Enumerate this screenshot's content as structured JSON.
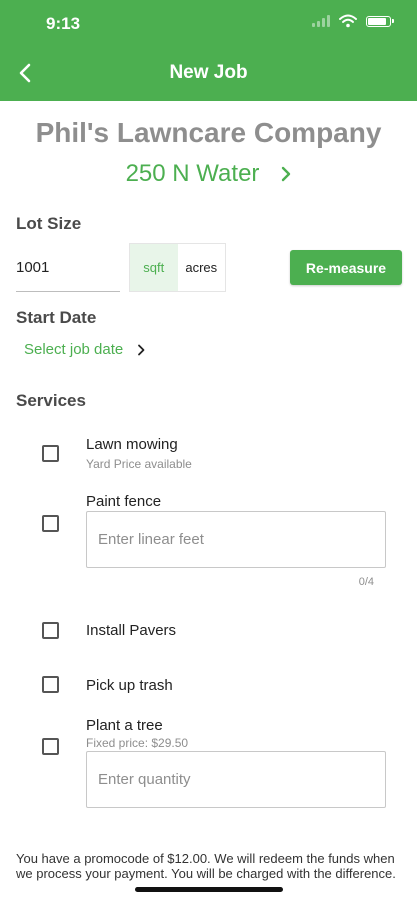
{
  "status_bar": {
    "time": "9:13"
  },
  "header": {
    "title": "New Job"
  },
  "company": {
    "name": "Phil's Lawncare Company",
    "address": "250 N Water"
  },
  "lot_size": {
    "heading": "Lot Size",
    "value": "1001",
    "units": [
      "sqft",
      "acres"
    ],
    "selected_unit": "sqft",
    "remeasure_label": "Re-measure"
  },
  "start_date": {
    "heading": "Start Date",
    "select_label": "Select job date"
  },
  "services": {
    "heading": "Services",
    "items": [
      {
        "label": "Lawn mowing",
        "sub": "Yard Price available"
      },
      {
        "label": "Paint fence",
        "placeholder": "Enter linear feet",
        "counter": "0/4"
      },
      {
        "label": "Install Pavers"
      },
      {
        "label": "Pick up trash"
      },
      {
        "label": "Plant a tree",
        "sub": "Fixed price: $29.50",
        "placeholder": "Enter quantity"
      }
    ]
  },
  "promo": {
    "text": "You have a promocode of $12.00. We will redeem the funds when we process your payment. You will be charged with the difference."
  },
  "colors": {
    "accent": "#4caf50",
    "muted": "#8e8e8e"
  }
}
